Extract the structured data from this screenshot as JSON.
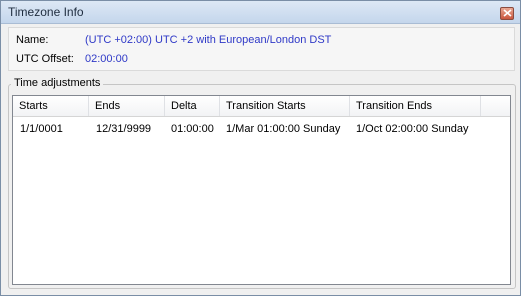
{
  "window": {
    "title": "Timezone Info"
  },
  "info": {
    "name_label": "Name:",
    "name_value": "(UTC +02:00) UTC +2 with European/London DST",
    "offset_label": "UTC Offset:",
    "offset_value": "02:00:00"
  },
  "adjustments": {
    "group_title": "Time adjustments",
    "columns": [
      "Starts",
      "Ends",
      "Delta",
      "Transition Starts",
      "Transition Ends"
    ],
    "rows": [
      [
        "1/1/0001",
        "12/31/9999",
        "01:00:00",
        "1/Mar 01:00:00 Sunday",
        "1/Oct 02:00:00 Sunday"
      ]
    ]
  },
  "colors": {
    "value_text": "#2f39c7",
    "close_button": "#c9553d"
  },
  "icons": {
    "close": "close-icon"
  }
}
